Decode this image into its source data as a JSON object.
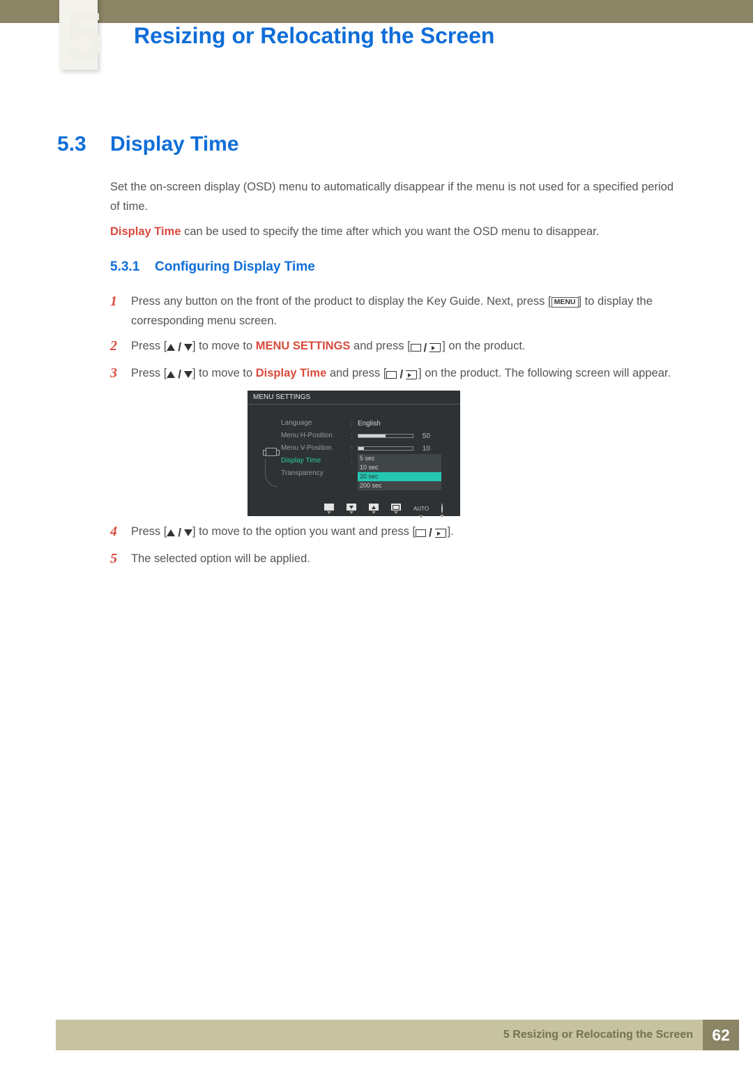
{
  "chapter": {
    "big_number": "5",
    "title": "Resizing or Relocating the Screen"
  },
  "section": {
    "number": "5.3",
    "title": "Display Time"
  },
  "intro": {
    "p1": "Set the on-screen display (OSD) menu to automatically disappear if the menu is not used for a specified period of time.",
    "p2_em": "Display Time",
    "p2_rest": " can be used to specify the time after which you want the OSD menu to disappear."
  },
  "subsection": {
    "number": "5.3.1",
    "title": "Configuring Display Time"
  },
  "steps": {
    "s1": {
      "num": "1",
      "a": "Press any button on the front of the product to display the Key Guide. Next, press [",
      "menu": "MENU",
      "b": "] to display the corresponding menu screen."
    },
    "s2": {
      "num": "2",
      "a": "Press [",
      "b": "] to move to ",
      "em": "MENU SETTINGS",
      "c": " and press [",
      "d": "] on the product."
    },
    "s3": {
      "num": "3",
      "a": "Press [",
      "b": "] to move to ",
      "em": "Display Time",
      "c": " and press [",
      "d": "] on the product. The following screen will appear."
    },
    "s4": {
      "num": "4",
      "a": "Press [",
      "b": "] to move to the option you want and press [",
      "c": "]."
    },
    "s5": {
      "num": "5",
      "a": "The selected option will be applied."
    }
  },
  "osd": {
    "title": "MENU SETTINGS",
    "items": {
      "language": "Language",
      "menu_h": "Menu H-Position",
      "menu_v": "Menu V-Position",
      "display_time": "Display Time",
      "transparency": "Transparency"
    },
    "values": {
      "language": "English",
      "menu_h": "50",
      "menu_v": "10",
      "menu_h_fill": 50,
      "menu_v_fill": 10
    },
    "dropdown": [
      "5 sec",
      "10 sec",
      "20 sec",
      "200 sec"
    ],
    "dropdown_selected_index": 2,
    "bottom": {
      "auto": "AUTO"
    }
  },
  "footer": {
    "chapter_ref": "5 Resizing or Relocating the Screen",
    "page": "62"
  }
}
